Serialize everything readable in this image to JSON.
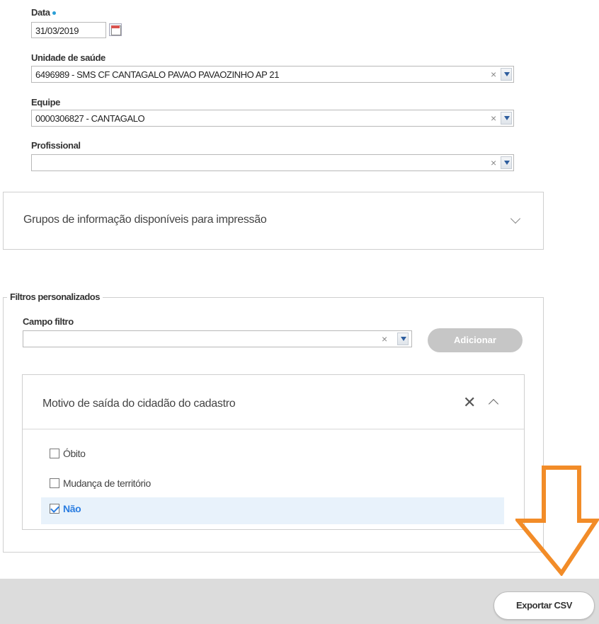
{
  "form": {
    "date": {
      "label": "Data",
      "value": "31/03/2019"
    },
    "health_unit": {
      "label": "Unidade de saúde",
      "value": "6496989 - SMS CF CANTAGALO PAVAO PAVAOZINHO AP 21"
    },
    "team": {
      "label": "Equipe",
      "value": "0000306827 - CANTAGALO"
    },
    "professional": {
      "label": "Profissional",
      "value": ""
    },
    "clear_symbol": "×"
  },
  "print_groups": {
    "title": "Grupos de informação disponíveis para impressão"
  },
  "custom_filters": {
    "legend": "Filtros personalizados",
    "filter_field_label": "Campo filtro",
    "filter_field_value": "",
    "add_button": "Adicionar",
    "panel": {
      "title": "Motivo de saída do cidadão do cadastro",
      "close_symbol": "✕",
      "options": [
        {
          "label": "Óbito",
          "checked": false
        },
        {
          "label": "Mudança de território",
          "checked": false
        },
        {
          "label": "Não",
          "checked": true
        }
      ]
    }
  },
  "footer": {
    "export_button": "Exportar CSV"
  },
  "colors": {
    "accent_blue": "#2a7de1",
    "annotation_orange": "#f28c28",
    "footer_gray": "#dcdcdc",
    "disabled_button": "#c6c6c6"
  },
  "icons": [
    "calendar-icon",
    "clear-icon",
    "dropdown-arrow-icon",
    "chevron-down-icon",
    "close-icon",
    "chevron-up-icon",
    "checkbox-icon",
    "down-arrow-annotation-icon"
  ]
}
